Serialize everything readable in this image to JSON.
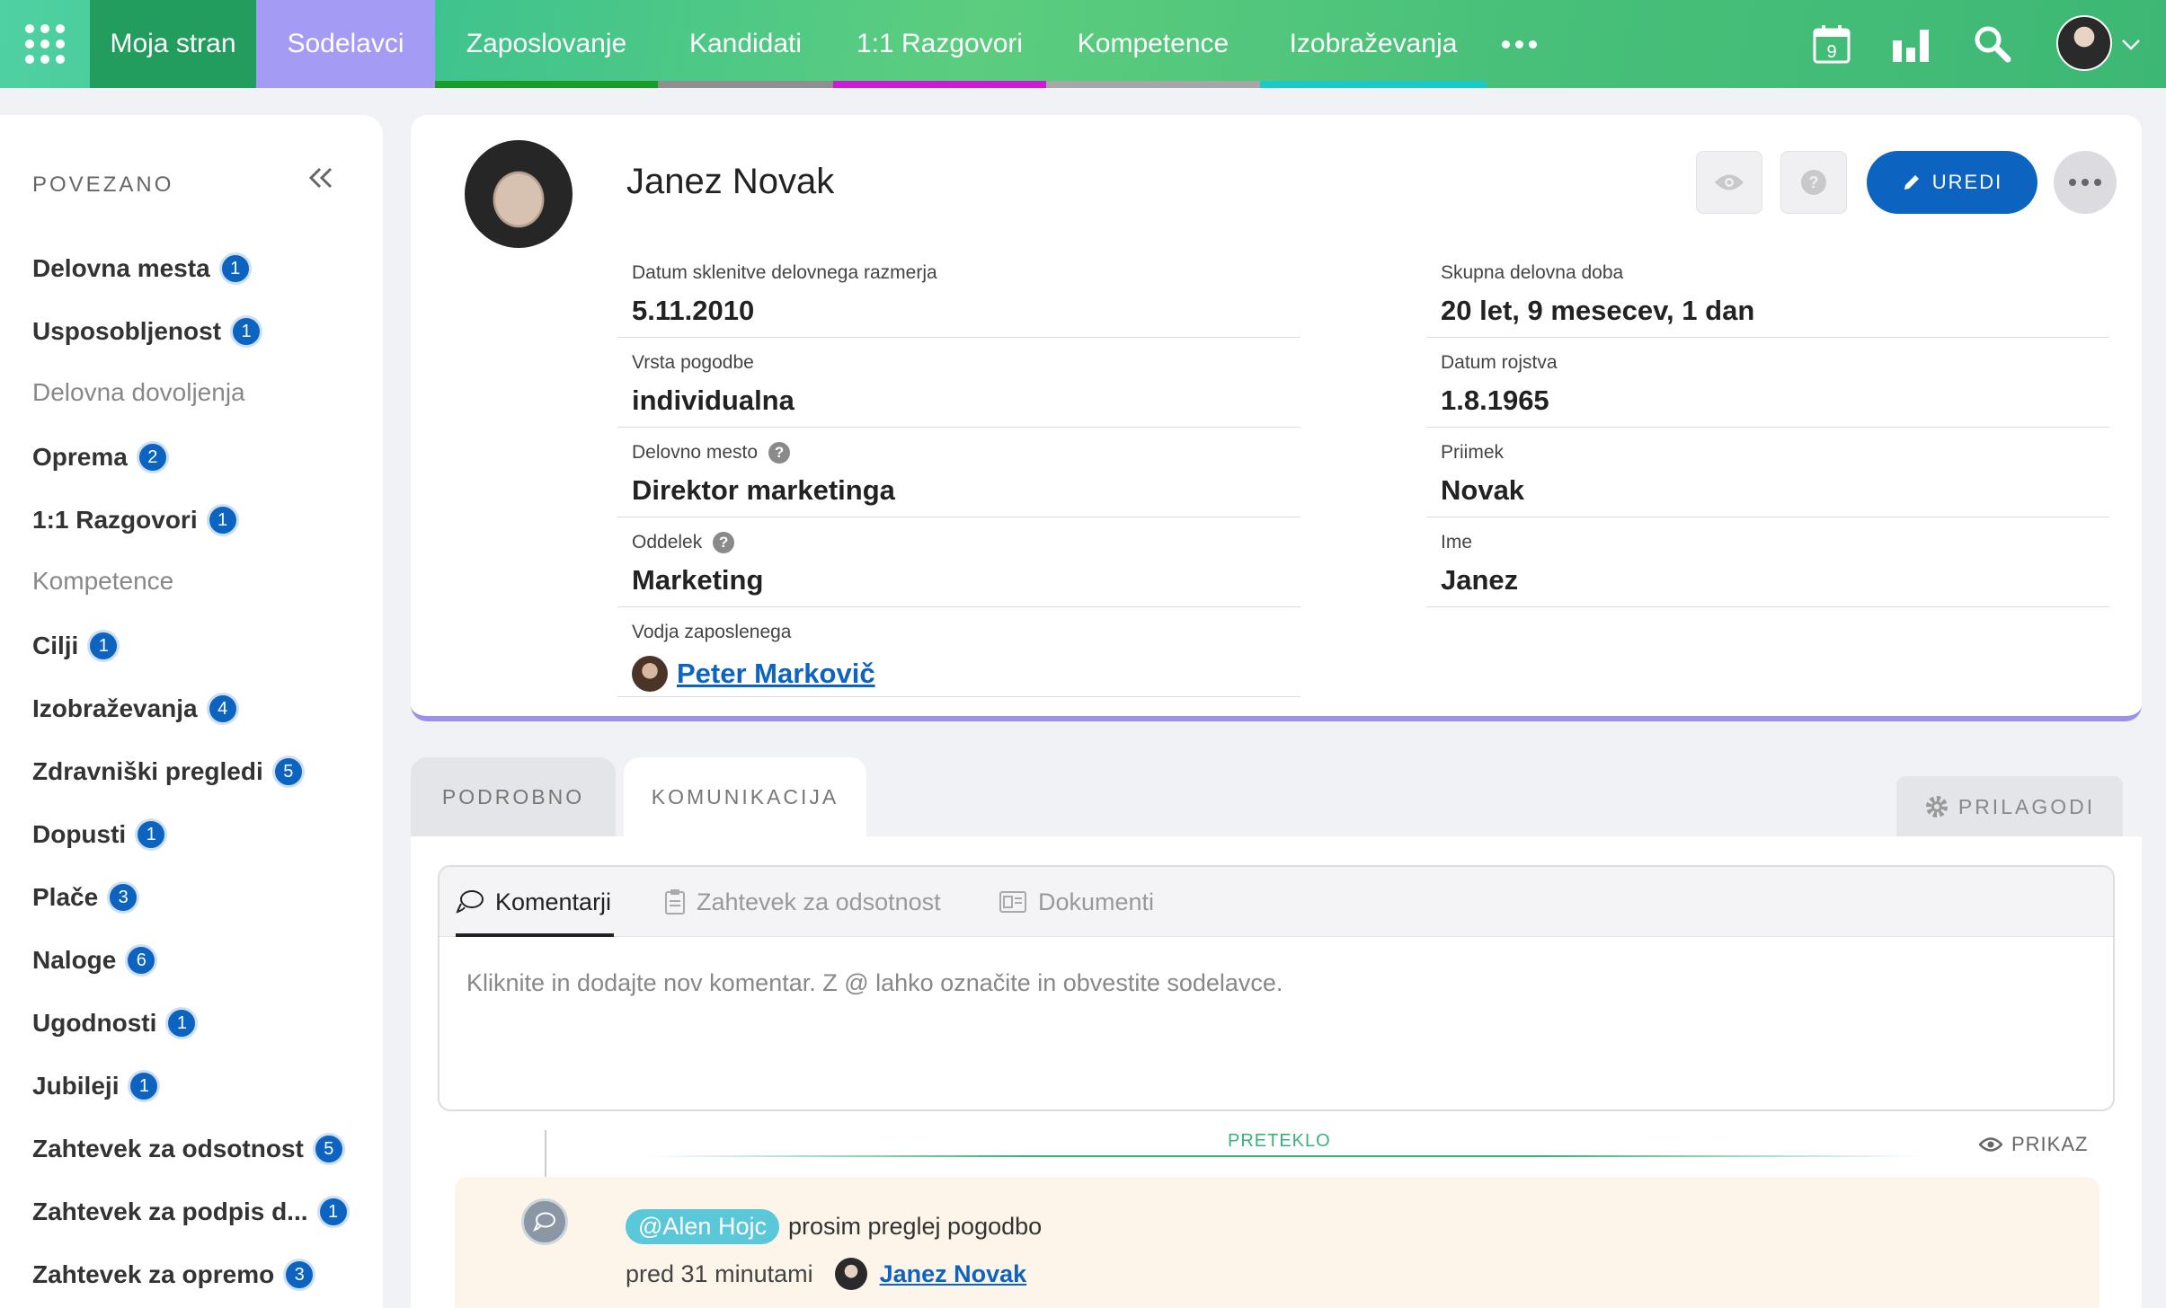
{
  "nav": {
    "items": [
      {
        "label": "Moja stran"
      },
      {
        "label": "Sodelavci"
      },
      {
        "label": "Zaposlovanje",
        "bar_color": "#1a9b2a"
      },
      {
        "label": "Kandidati",
        "bar_color": "#8f8f8f"
      },
      {
        "label": "1:1 Razgovori",
        "bar_color": "#cc1ad6"
      },
      {
        "label": "Kompetence",
        "bar_color": "#a6a6a6"
      },
      {
        "label": "Izobraževanja",
        "bar_color": "#1ec8c8"
      }
    ],
    "calendar_day": "9"
  },
  "sidebar": {
    "title": "POVEZANO",
    "items": [
      {
        "label": "Delovna mesta",
        "count": "1"
      },
      {
        "label": "Usposobljenost",
        "count": "1"
      },
      {
        "label": "Delovna dovoljenja",
        "count": ""
      },
      {
        "label": "Oprema",
        "count": "2"
      },
      {
        "label": "1:1 Razgovori",
        "count": "1"
      },
      {
        "label": "Kompetence",
        "count": ""
      },
      {
        "label": "Cilji",
        "count": "1"
      },
      {
        "label": "Izobraževanja",
        "count": "4"
      },
      {
        "label": "Zdravniški pregledi",
        "count": "5"
      },
      {
        "label": "Dopusti",
        "count": "1"
      },
      {
        "label": "Plače",
        "count": "3"
      },
      {
        "label": "Naloge",
        "count": "6"
      },
      {
        "label": "Ugodnosti",
        "count": "1"
      },
      {
        "label": "Jubileji",
        "count": "1"
      },
      {
        "label": "Zahtevek za odsotnost",
        "count": "5"
      },
      {
        "label": "Zahtevek za podpis d...",
        "count": "1"
      },
      {
        "label": "Zahtevek za opremo",
        "count": "3"
      }
    ]
  },
  "profile": {
    "name": "Janez Novak",
    "edit_label": "UREDI",
    "left_fields": [
      {
        "label": "Datum sklenitve delovnega razmerja",
        "value": "5.11.2010"
      },
      {
        "label": "Vrsta pogodbe",
        "value": "individualna"
      },
      {
        "label": "Delovno mesto",
        "value": "Direktor marketinga"
      },
      {
        "label": "Oddelek",
        "value": "Marketing"
      },
      {
        "label": "Vodja zaposlenega",
        "value": "Peter Markovič"
      }
    ],
    "right_fields": [
      {
        "label": "Skupna delovna doba",
        "value": "20 let, 9 mesecev, 1 dan"
      },
      {
        "label": "Datum rojstva",
        "value": "1.8.1965"
      },
      {
        "label": "Priimek",
        "value": "Novak"
      },
      {
        "label": "Ime",
        "value": "Janez"
      }
    ]
  },
  "tabs": {
    "podrobno": "PODROBNO",
    "komunikacija": "KOMUNIKACIJA",
    "prilagodi": "PRILAGODI"
  },
  "communication": {
    "tabs": [
      "Komentarji",
      "Zahtevek za odsotnost",
      "Dokumenti"
    ],
    "placeholder": "Kliknite in dodajte nov komentar. Z @ lahko označite in obvestite sodelavce.",
    "divider_label": "PRETEKLO",
    "view_label": "PRIKAZ",
    "comment": {
      "mention": "@Alen Hojc",
      "text": "prosim preglej pogodbo",
      "time": "pred 31 minutami",
      "author": "Janez Novak"
    }
  },
  "colors": {
    "accent": "#0c63c0",
    "active_nav": "#a49bf5",
    "home_nav": "#239d5e",
    "card_border": "#9b90ee"
  }
}
